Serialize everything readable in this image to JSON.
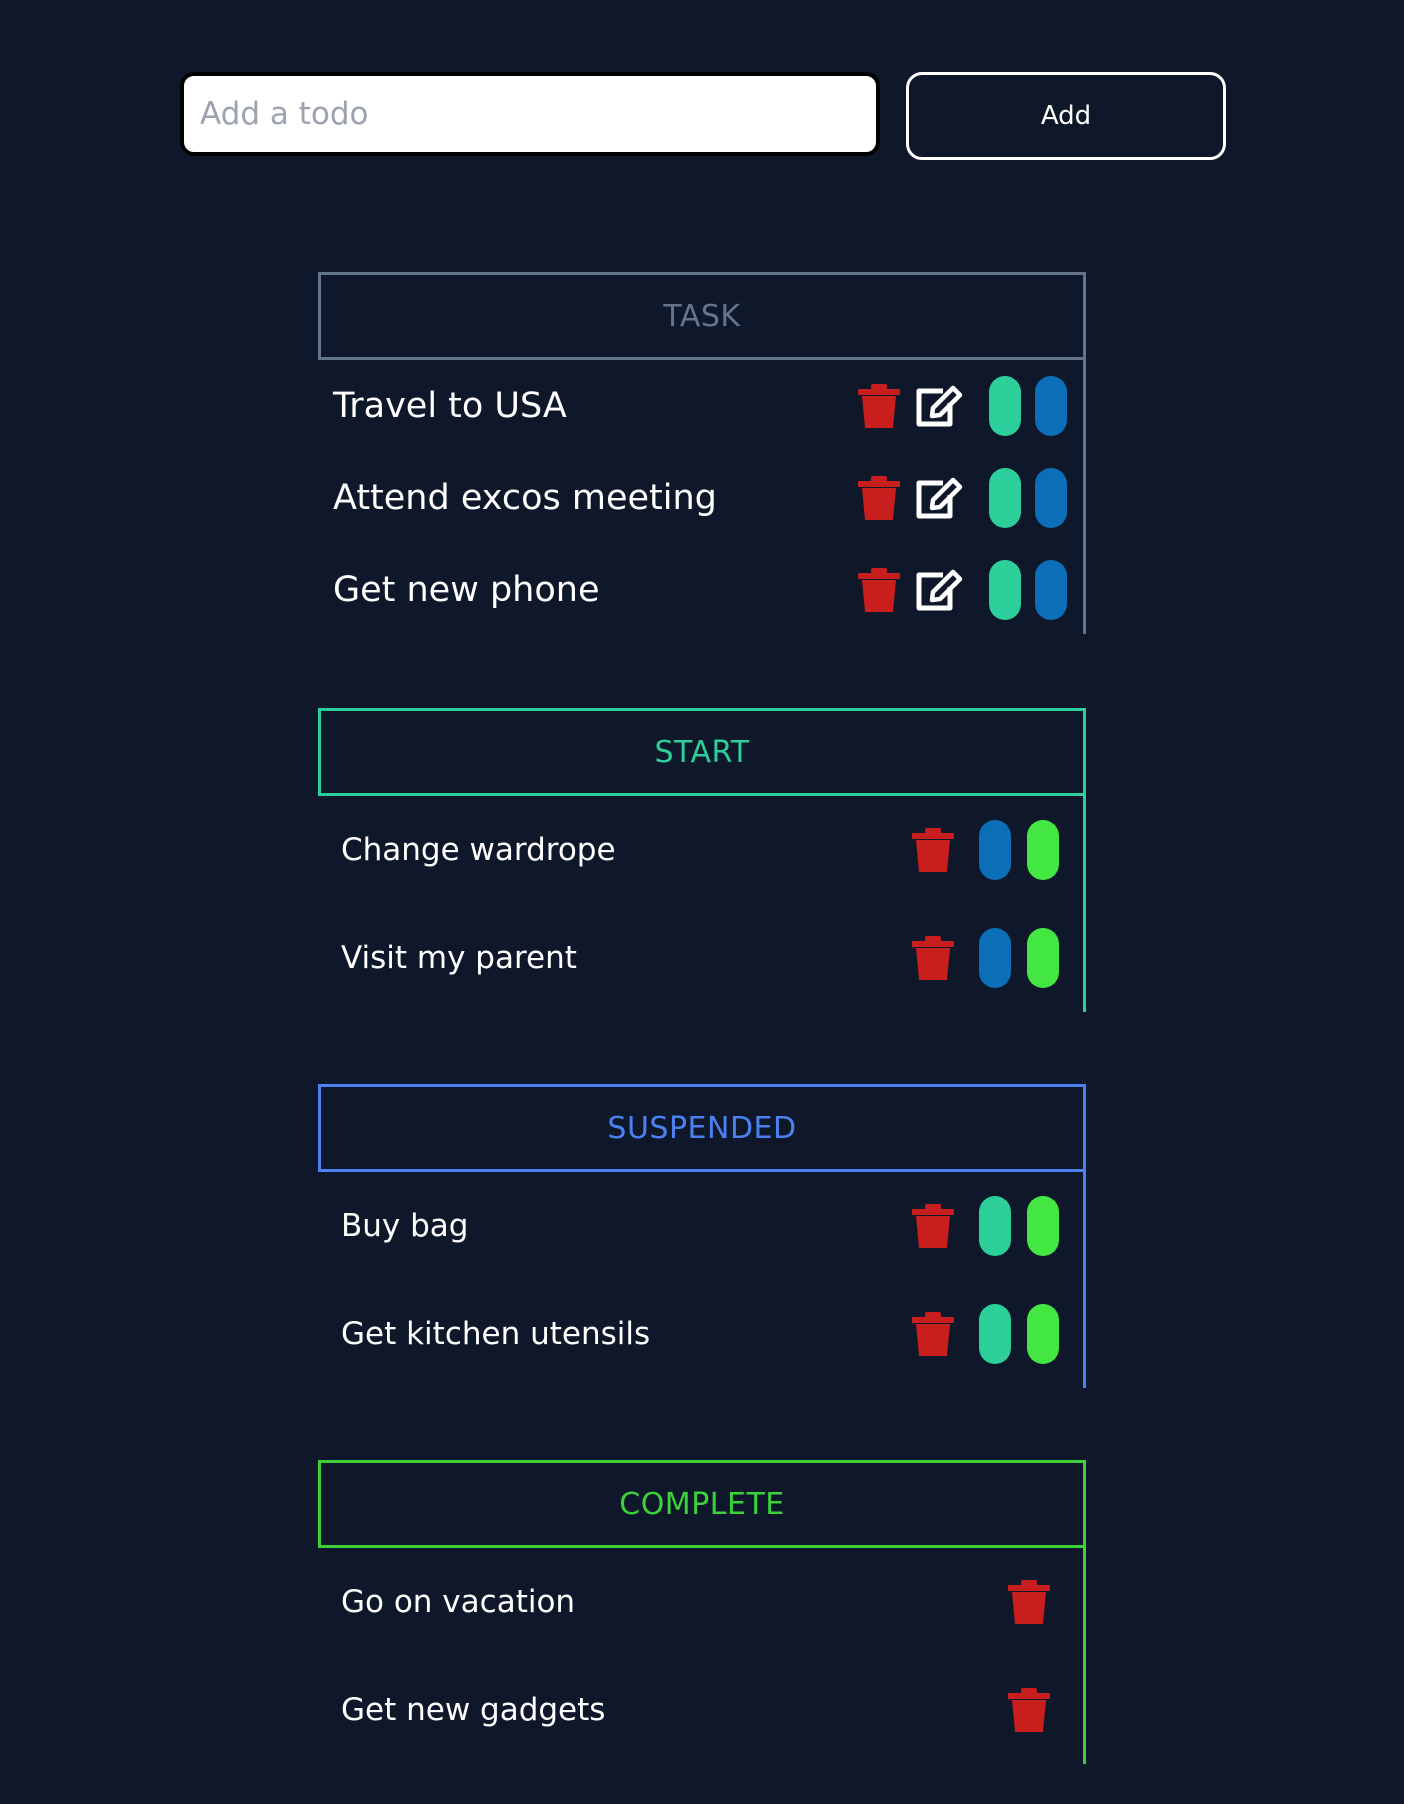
{
  "add_bar": {
    "input_placeholder": "Add a todo",
    "input_value": "",
    "add_label": "Add"
  },
  "colors": {
    "background": "#0f172a",
    "task": "#64748b",
    "start": "#2ccf9a",
    "suspended": "#4a80f0",
    "complete": "#3bd13b",
    "delete_icon": "#c81e1e",
    "move_to_start": "#2ccf9a",
    "move_to_suspended": "#0a6fb6",
    "move_to_complete": "#42e742"
  },
  "sections": {
    "task": {
      "title": "TASK",
      "items": [
        "Travel to USA",
        "Attend excos meeting",
        "Get new phone"
      ],
      "icons": [
        "trash-icon",
        "edit-icon",
        "start-pill",
        "suspend-pill"
      ]
    },
    "start": {
      "title": "START",
      "items": [
        "Change wardrope",
        "Visit my parent"
      ],
      "icons": [
        "trash-icon",
        "suspend-pill",
        "complete-pill"
      ]
    },
    "suspended": {
      "title": "SUSPENDED",
      "items": [
        "Buy bag",
        "Get kitchen utensils"
      ],
      "icons": [
        "trash-icon",
        "start-pill",
        "complete-pill"
      ]
    },
    "complete": {
      "title": "COMPLETE",
      "items": [
        "Go on vacation",
        "Get new gadgets"
      ],
      "icons": [
        "trash-icon"
      ]
    }
  }
}
